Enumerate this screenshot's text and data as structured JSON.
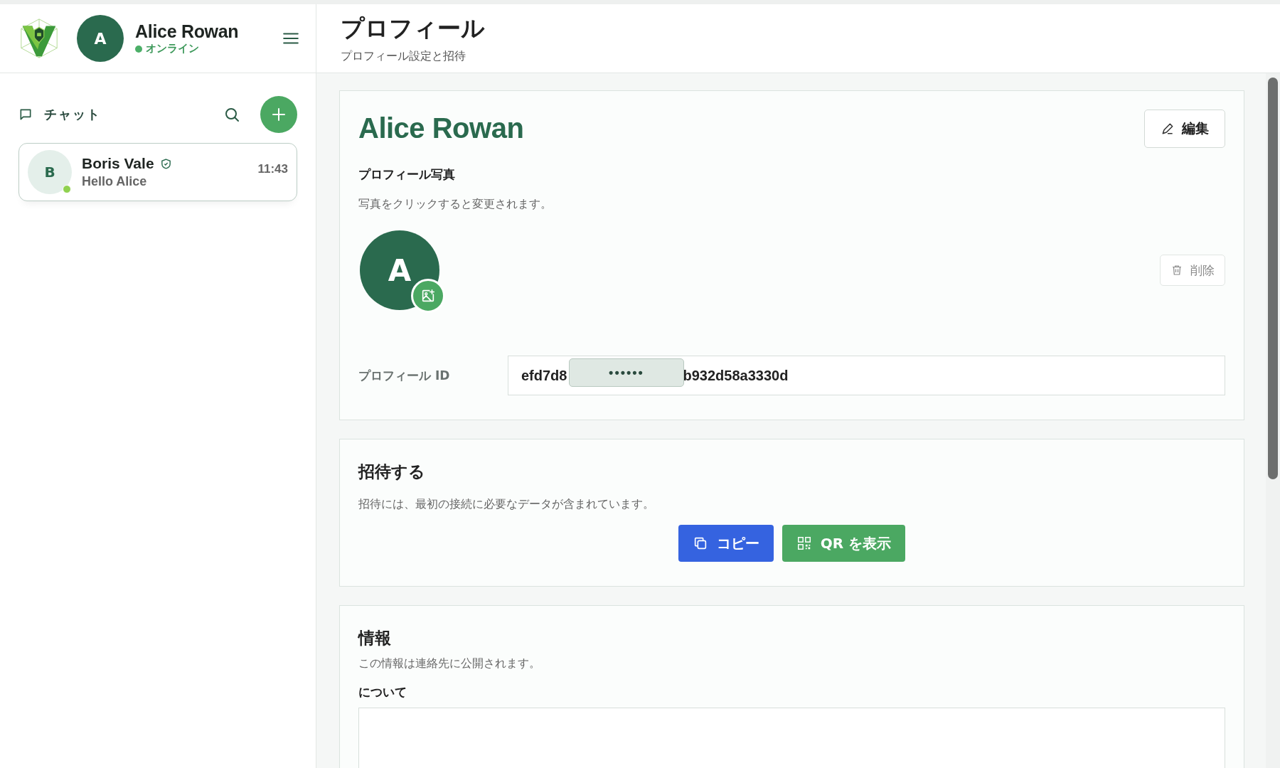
{
  "user": {
    "initial": "A",
    "name": "Alice Rowan",
    "status": "オンライン",
    "online": true
  },
  "page": {
    "title": "プロフィール",
    "subtitle": "プロフィール設定と招待"
  },
  "sidebar": {
    "section_title": "チャット",
    "chats": [
      {
        "initial": "B",
        "name": "Boris Vale",
        "verified": true,
        "online": true,
        "message": "Hello Alice",
        "time": "11:43",
        "selected": true
      }
    ]
  },
  "profile": {
    "name": "Alice Rowan",
    "edit_button": "編集",
    "photo_title": "プロフィール写真",
    "photo_hint": "写真をクリックすると変更されます。",
    "avatar_initial": "A",
    "delete_button": "削除",
    "id_label": "プロフィール ID",
    "id_start": "efd7d8",
    "id_mask": "••••••",
    "id_end": "b932d58a3330d"
  },
  "invite": {
    "title": "招待する",
    "description": "招待には、最初の接続に必要なデータが含まれています。",
    "copy_button": "コピー",
    "qr_button": "QR を表示"
  },
  "info": {
    "title": "情報",
    "description": "この情報は連絡先に公開されます。",
    "about_label": "について"
  }
}
